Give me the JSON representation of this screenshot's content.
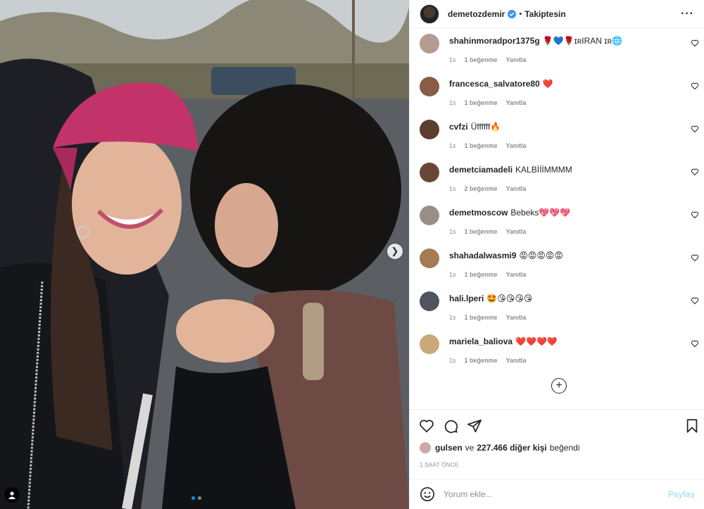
{
  "post": {
    "author": "demetozdemir",
    "follow_state": "Takiptesin",
    "bullet": "•",
    "more_icon": "more-horizontal-icon"
  },
  "comments": [
    {
      "username": "shahinmoradpor1375g",
      "text": "🌹💙🌹ɪʀIRAN ɪʀ🌐",
      "time": "1s",
      "likes": "1 beğenme",
      "reply": "Yanıtla",
      "avatar_color": "#b59a90"
    },
    {
      "username": "francesca_salvatore80",
      "text": "❤️",
      "time": "1s",
      "likes": "1 beğenme",
      "reply": "Yanıtla",
      "avatar_color": "#8a5b46"
    },
    {
      "username": "cvfzi",
      "text": "Üffffff🔥",
      "time": "1s",
      "likes": "1 beğenme",
      "reply": "Yanıtla",
      "avatar_color": "#5c3d2e"
    },
    {
      "username": "demetciamadeli",
      "text": "KALBİİİMMMM",
      "time": "1s",
      "likes": "2 beğenme",
      "reply": "Yanıtla",
      "avatar_color": "#6b4638"
    },
    {
      "username": "demetmoscow",
      "text": "Bebeks💖💖💖",
      "time": "1s",
      "likes": "1 beğenme",
      "reply": "Yanıtla",
      "avatar_color": "#9a8f88"
    },
    {
      "username": "shahadalwasmi9",
      "text": "😡😡😡😡😡",
      "time": "1s",
      "likes": "1 beğenme",
      "reply": "Yanıtla",
      "avatar_color": "#a67a55"
    },
    {
      "username": "hali.lperi",
      "text": "🤩😘😘😘😘",
      "time": "1s",
      "likes": "1 beğenme",
      "reply": "Yanıtla",
      "avatar_color": "#4f5560"
    },
    {
      "username": "mariela_baliova",
      "text": "❤️❤️❤️❤️",
      "time": "1s",
      "likes": "1 beğenme",
      "reply": "Yanıtla",
      "avatar_color": "#c9a97a"
    }
  ],
  "likes": {
    "first_liker": "gulsen",
    "connector": "ve",
    "count": "227.466 diğer kişi",
    "suffix": "beğendi"
  },
  "time_ago": "1 SAAT ÖNCE",
  "add_comment": {
    "placeholder": "Yorum ekle...",
    "post_label": "Paylaş"
  },
  "carousel": {
    "dots": 2,
    "active": 0
  },
  "colors": {
    "verified": "#3897f0",
    "accent": "#0095f6",
    "cap": "#c2336a"
  }
}
